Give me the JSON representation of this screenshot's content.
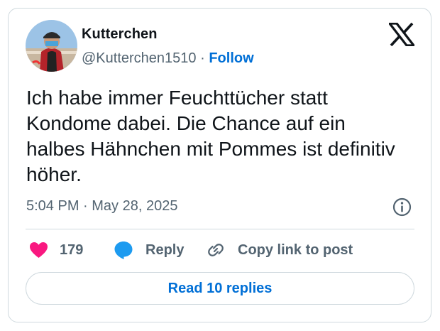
{
  "author": {
    "display_name": "Kutterchen",
    "handle": "@Kutterchen1510",
    "separator": "·",
    "follow_label": "Follow"
  },
  "tweet": {
    "text": "Ich habe immer Feuchttücher statt Kondome dabei. Die Chance auf ein halbes Hähnchen mit Pommes ist definitiv höher.",
    "timestamp": "5:04 PM · May 28, 2025"
  },
  "actions": {
    "like_count": "179",
    "reply_label": "Reply",
    "copy_link_label": "Copy link to post"
  },
  "read_replies_label": "Read 10 replies",
  "icons": {
    "logo": "x-logo",
    "like": "heart-icon",
    "reply": "speech-bubble-icon",
    "copy": "link-icon",
    "info": "info-icon"
  },
  "colors": {
    "like": "#f91880",
    "reply_bubble": "#1d9bf0",
    "link_accent": "#006fd6",
    "muted_text": "#536471",
    "border": "#cfd9de"
  }
}
